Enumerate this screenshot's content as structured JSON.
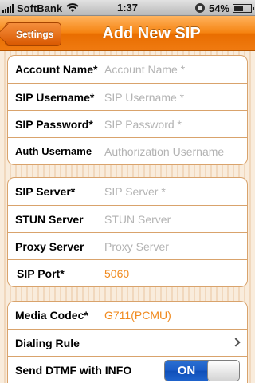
{
  "status_bar": {
    "carrier": "SoftBank",
    "time": "1:37",
    "battery_percent_label": "54%",
    "battery_level": 0.54,
    "icons": [
      "signal-icon",
      "wifi-icon",
      "lock-rotation-icon",
      "battery-icon"
    ]
  },
  "nav": {
    "back_label": "Settings",
    "title": "Add New SIP"
  },
  "account_group": [
    {
      "label": "Account Name*",
      "placeholder": "Account Name *"
    },
    {
      "label": "SIP Username*",
      "placeholder": "SIP Username *"
    },
    {
      "label": "SIP Password*",
      "placeholder": "SIP Password *"
    },
    {
      "label": "Auth Username",
      "placeholder": "Authorization Username"
    }
  ],
  "server_group": [
    {
      "label": "SIP Server*",
      "placeholder": "SIP Server *"
    },
    {
      "label": "STUN Server",
      "placeholder": "STUN Server"
    },
    {
      "label": "Proxy Server",
      "placeholder": "Proxy Server"
    },
    {
      "label": "SIP Port*",
      "value": "5060"
    }
  ],
  "options_group": {
    "media_codec": {
      "label": "Media Codec*",
      "value": "G711(PCMU)"
    },
    "dialing_rule": {
      "label": "Dialing Rule"
    },
    "dtmf": {
      "label": "Send DTMF with INFO",
      "state": "ON"
    }
  },
  "colors": {
    "accent": "#f5820f",
    "value_text": "#f08a1e",
    "toggle_on": "#1a5cc7"
  }
}
